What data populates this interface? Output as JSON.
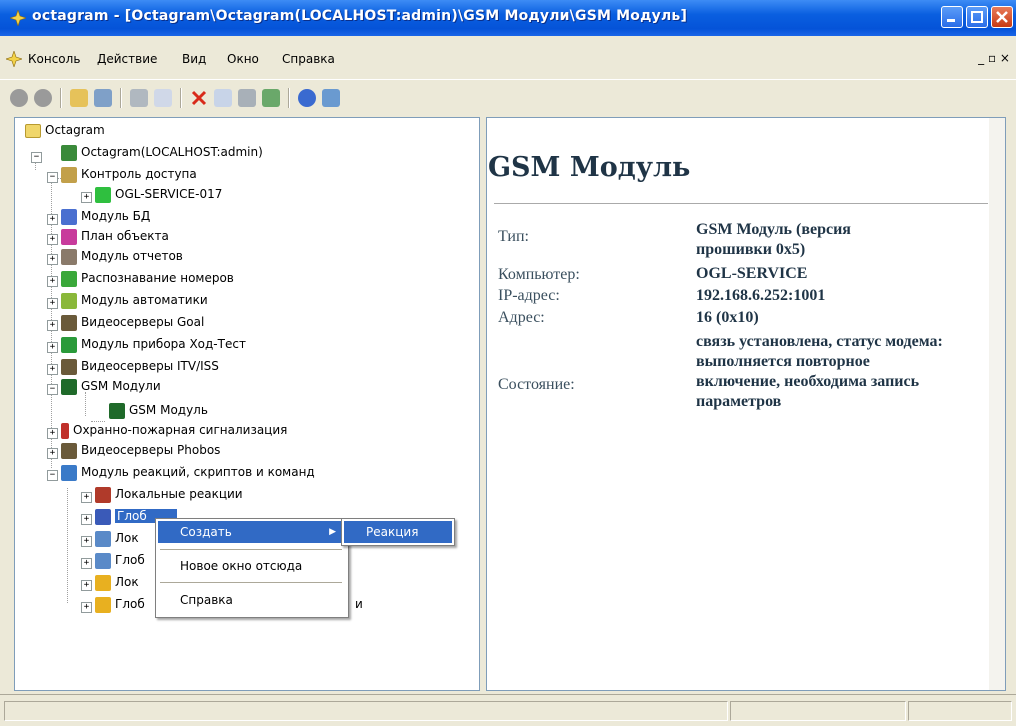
{
  "window": {
    "title": "octagram - [Octagram\\Octagram(LOCALHOST:admin)\\GSM Модули\\GSM Модуль]",
    "title_color": "#0a5fe0"
  },
  "menu": {
    "items": [
      "Консоль",
      "Действие",
      "Вид",
      "Окно",
      "Справка"
    ],
    "mdi_controls": "_ ▫ ×"
  },
  "toolbar": {
    "icons": [
      "back-icon",
      "forward-icon",
      "up-folder-icon",
      "show-tree-icon",
      "cut-icon",
      "copy-icon",
      "delete-icon",
      "properties-icon",
      "print-icon",
      "refresh-icon",
      "help-icon",
      "new-window-icon"
    ]
  },
  "tree": [
    {
      "label": "Octagram",
      "icon": "folder-icon",
      "color": "#e8d48a"
    },
    {
      "label": "Octagram(LOCALHOST:admin)",
      "icon": "server-icon",
      "color": "#3a8a3a"
    },
    {
      "label": "Контроль доступа",
      "icon": "lock-icon",
      "color": "#c2a04a"
    },
    {
      "label": "OGL-SERVICE-017",
      "icon": "door-icon",
      "color": "#2fbf3f"
    },
    {
      "label": "Модуль БД",
      "icon": "database-icon",
      "color": "#4a6fd0"
    },
    {
      "label": "План объекта",
      "icon": "map-icon",
      "color": "#c83b9c"
    },
    {
      "label": "Модуль отчетов",
      "icon": "report-icon",
      "color": "#8a7a6a"
    },
    {
      "label": "Распознавание номеров",
      "icon": "plate-icon",
      "color": "#3aa83a"
    },
    {
      "label": "Модуль автоматики",
      "icon": "automation-icon",
      "color": "#8ab83a"
    },
    {
      "label": "Видеосерверы Goal",
      "icon": "camera-icon",
      "color": "#6a5a3a"
    },
    {
      "label": "Модуль прибора Ход-Тест",
      "icon": "device-icon",
      "color": "#2a9a3a"
    },
    {
      "label": "Видеосерверы ITV/ISS",
      "icon": "camera-icon",
      "color": "#6a5a3a"
    },
    {
      "label": "GSM Модули",
      "icon": "gsm-icon",
      "color": "#1f6a2a"
    },
    {
      "label": "GSM Модуль",
      "icon": "gsm-icon",
      "color": "#1f6a2a"
    },
    {
      "label": "Охранно-пожарная сигнализация",
      "icon": "fire-icon",
      "color": "#c0302a"
    },
    {
      "label": "Видеосерверы Phobos",
      "icon": "camera-icon",
      "color": "#6a5a3a"
    },
    {
      "label": "Модуль реакций, скриптов и команд",
      "icon": "script-icon",
      "color": "#3a7ac8"
    },
    {
      "label": "Локальные реакции",
      "icon": "reaction-icon",
      "color": "#b03a2a"
    },
    {
      "label": "Глоб",
      "icon": "global-reaction-icon",
      "color": "#3a5ab8"
    },
    {
      "label": "Лок",
      "icon": "local-script-icon",
      "color": "#5a8ac8"
    },
    {
      "label": "Глоб",
      "icon": "global-script-icon",
      "color": "#5a8ac8"
    },
    {
      "label": "Лок",
      "icon": "local-command-icon",
      "color": "#e8b020"
    },
    {
      "label": "Глоб",
      "icon": "global-command-icon",
      "color": "#e8b020"
    }
  ],
  "tree_partial_tail": "и",
  "details": {
    "heading": "GSM Модуль",
    "labels": {
      "type": "Тип:",
      "computer": "Компьютер:",
      "ip": "IP-адрес:",
      "address": "Адрес:",
      "state": "Состояние:"
    },
    "values": {
      "type": "GSM Модуль (версия прошивки 0x5)",
      "computer": "OGL-SERVICE",
      "ip": "192.168.6.252:1001",
      "address": "16 (0x10)",
      "state": "связь установлена, статус модема: выполняется повторное включение, необходима запись параметров"
    }
  },
  "context_menu": {
    "create": "Создать",
    "new_window": "Новое окно отсюда",
    "help": "Справка",
    "submenu_reaction": "Реакция",
    "highlight_color": "#316ac5"
  }
}
